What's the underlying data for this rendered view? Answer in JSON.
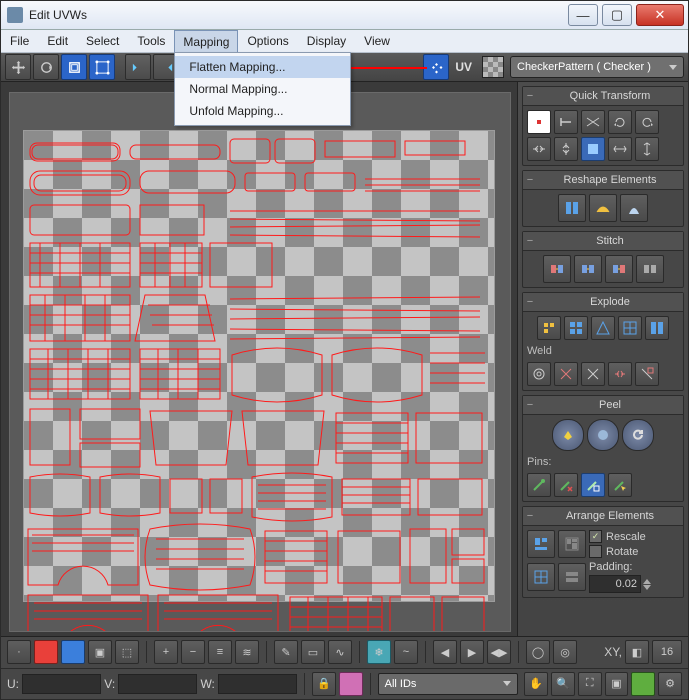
{
  "window": {
    "title": "Edit UVWs"
  },
  "menu": {
    "items": [
      "File",
      "Edit",
      "Select",
      "Tools",
      "Mapping",
      "Options",
      "Display",
      "View"
    ],
    "active": 4,
    "dropdown": [
      "Flatten Mapping...",
      "Normal Mapping...",
      "Unfold Mapping..."
    ]
  },
  "toolbar": {
    "uv": "UV",
    "pattern": "CheckerPattern  ( Checker )"
  },
  "panels": {
    "quick": "Quick Transform",
    "reshape": "Reshape Elements",
    "stitch": "Stitch",
    "explode": "Explode",
    "weld": "Weld",
    "peel": "Peel",
    "pins": "Pins:",
    "arrange": "Arrange Elements",
    "rescale": "Rescale",
    "rotate": "Rotate",
    "padding": "Padding:",
    "padv": "0.02"
  },
  "status": {
    "xy": "XY,",
    "coord": "16",
    "u": "U:",
    "v": "V:",
    "w": "W:",
    "allids": "All IDs"
  }
}
